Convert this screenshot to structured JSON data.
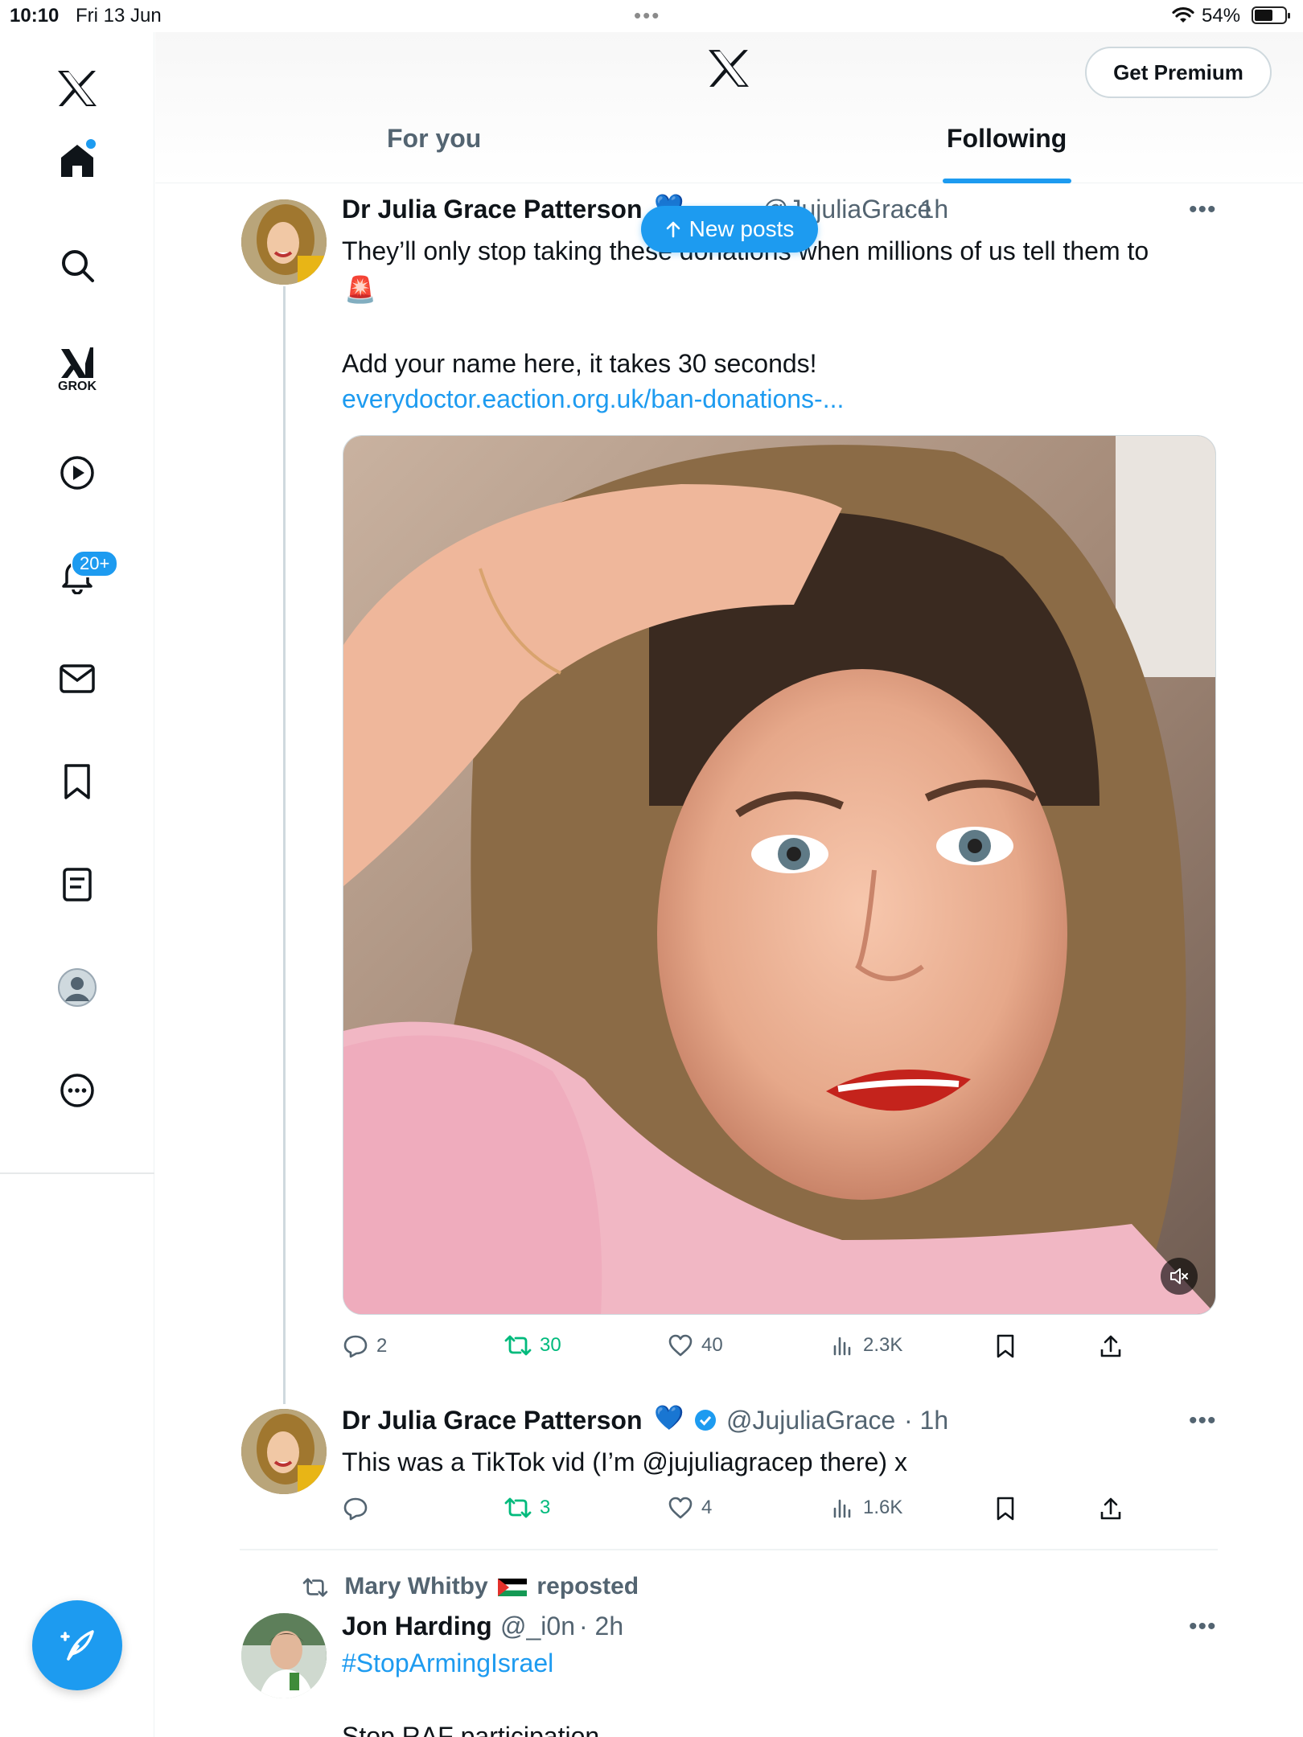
{
  "status_bar": {
    "time": "10:10",
    "date": "Fri 13 Jun",
    "battery": "54%"
  },
  "sidebar": {
    "items": [
      {
        "name": "home",
        "label": ""
      },
      {
        "name": "explore",
        "label": ""
      },
      {
        "name": "grok",
        "label": "GROK"
      },
      {
        "name": "video",
        "label": ""
      },
      {
        "name": "notifications",
        "label": ""
      },
      {
        "name": "messages",
        "label": ""
      },
      {
        "name": "bookmarks",
        "label": ""
      },
      {
        "name": "lists",
        "label": ""
      },
      {
        "name": "profile",
        "label": ""
      },
      {
        "name": "more",
        "label": ""
      }
    ],
    "notifications_badge": "20+"
  },
  "header": {
    "premium_label": "Get Premium",
    "tabs": [
      {
        "label": "For you",
        "active": false
      },
      {
        "label": "Following",
        "active": true
      }
    ]
  },
  "new_posts_label": "New posts",
  "posts": [
    {
      "name": "Dr Julia Grace Patterson",
      "handle": "@JujuliaGrace",
      "time": "· 1h",
      "text_line1": "They’ll only stop taking these donations when millions of us tell them to",
      "text_emoji": "🚨",
      "text_line2": "Add your name here, it takes 30 seconds!",
      "link": "everydoctor.eaction.org.uk/ban-donations-...",
      "stats": {
        "replies": "2",
        "reposts": "30",
        "likes": "40",
        "views": "2.3K"
      }
    },
    {
      "name": "Dr Julia Grace Patterson",
      "handle": "@JujuliaGrace",
      "time": "· 1h",
      "text": "This was a TikTok vid (I’m @jujuliagracep there) x",
      "stats": {
        "replies": "",
        "reposts": "3",
        "likes": "4",
        "views": "1.6K"
      }
    },
    {
      "reposted_by": "Mary Whitby",
      "reposted_suffix": "reposted",
      "name": "Jon Harding",
      "handle": "@_i0n",
      "time": "· 2h",
      "hashtag": "#StopArmingIsrael",
      "text_partial": "Stop RAF participation"
    }
  ],
  "colors": {
    "accent": "#1d9bf0",
    "repost_green": "#00ba7c",
    "secondary_text": "#536471"
  }
}
